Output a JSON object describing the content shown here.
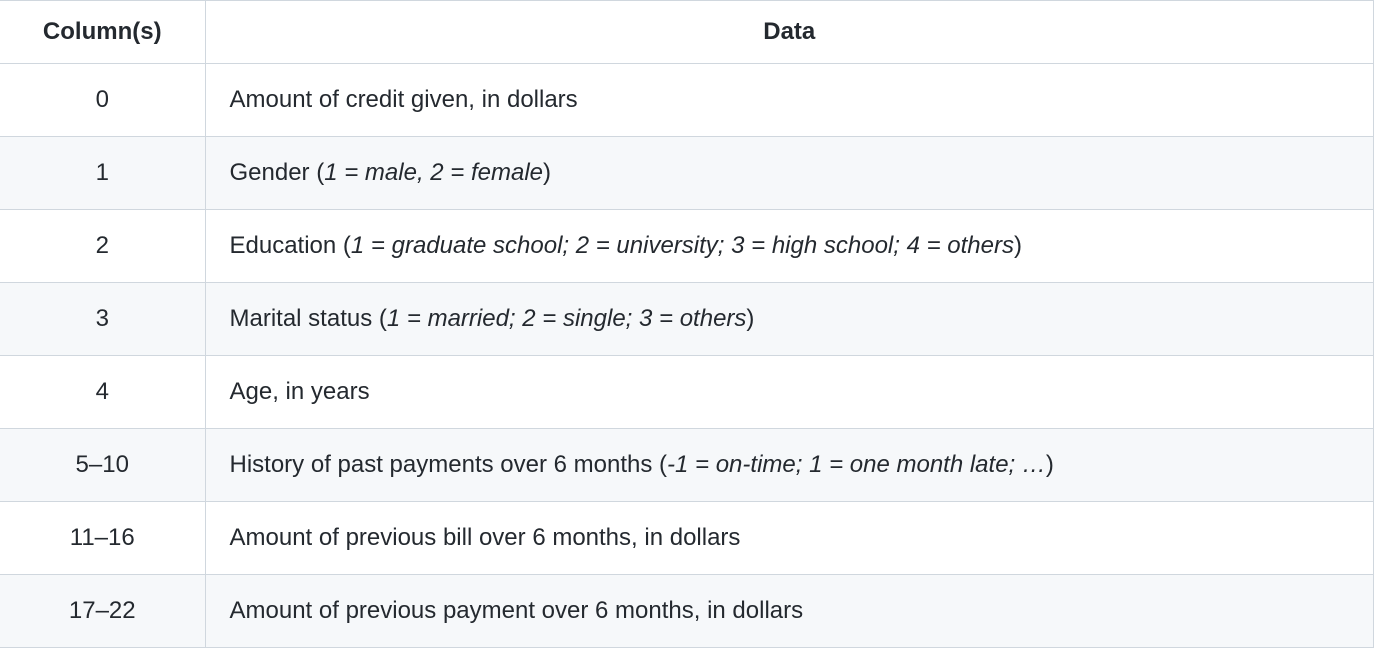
{
  "table": {
    "headers": {
      "col1": "Column(s)",
      "col2": "Data"
    },
    "rows": [
      {
        "col": "0",
        "desc": "Amount of credit given, in dollars",
        "detail": ""
      },
      {
        "col": "1",
        "desc": "Gender (",
        "detail": "1 = male, 2 = female",
        "suffix": ")"
      },
      {
        "col": "2",
        "desc": "Education (",
        "detail": "1 = graduate school; 2 = university; 3 = high school; 4 = others",
        "suffix": ")"
      },
      {
        "col": "3",
        "desc": "Marital status (",
        "detail": "1 = married; 2 = single; 3 = others",
        "suffix": ")"
      },
      {
        "col": "4",
        "desc": "Age, in years",
        "detail": ""
      },
      {
        "col": "5–10",
        "desc": "History of past payments over 6 months (",
        "detail": "-1 = on-time; 1 = one month late; …",
        "suffix": ")"
      },
      {
        "col": "11–16",
        "desc": "Amount of previous bill over 6 months, in dollars",
        "detail": ""
      },
      {
        "col": "17–22",
        "desc": "Amount of previous payment over 6 months, in dollars",
        "detail": ""
      }
    ]
  }
}
